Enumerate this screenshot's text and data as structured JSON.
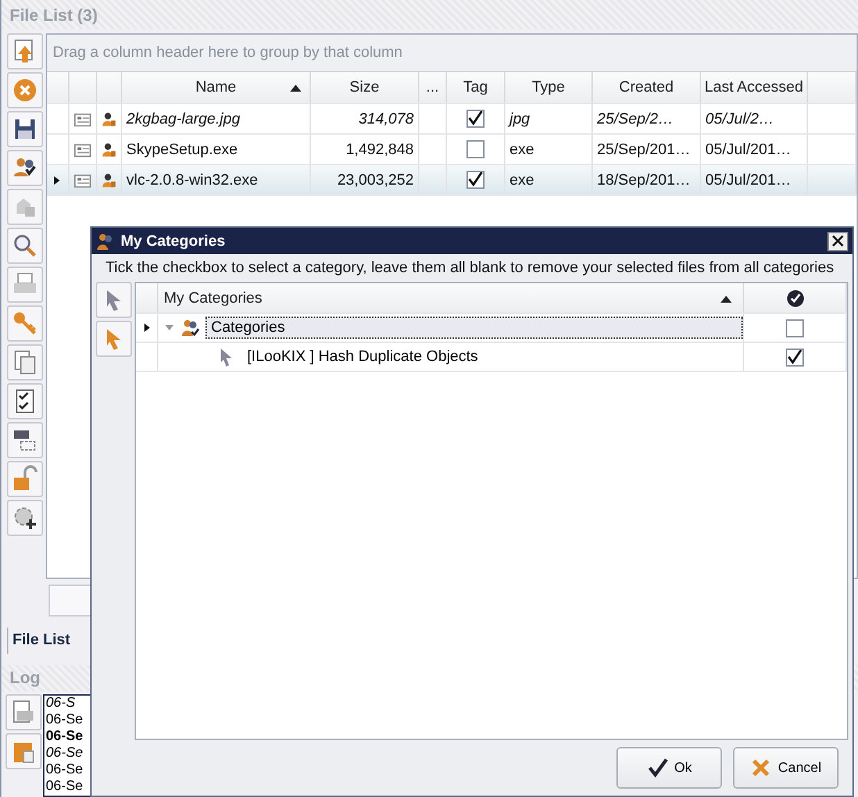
{
  "file_list": {
    "title": "File List (3)",
    "group_hint": "Drag a column header here to group by that column",
    "columns": [
      {
        "label": "Name",
        "sorted": true
      },
      {
        "label": "Size",
        "sorted": false
      },
      {
        "label": "...",
        "sorted": false
      },
      {
        "label": "Tag",
        "sorted": false
      },
      {
        "label": "Type",
        "sorted": false
      },
      {
        "label": "Created",
        "sorted": false
      },
      {
        "label": "Last Accessed",
        "sorted": false
      }
    ],
    "rows": [
      {
        "name": "2kgbag-large.jpg",
        "size": "314,078",
        "tag": true,
        "type": "jpg",
        "created": "25/Sep/2…",
        "accessed": "05/Jul/2…",
        "italic": true,
        "selected": false
      },
      {
        "name": "SkypeSetup.exe",
        "size": "1,492,848",
        "tag": false,
        "type": "exe",
        "created": "25/Sep/201…",
        "accessed": "05/Jul/201…",
        "italic": false,
        "selected": false
      },
      {
        "name": "vlc-2.0.8-win32.exe",
        "size": "23,003,252",
        "tag": true,
        "type": "exe",
        "created": "18/Sep/201…",
        "accessed": "05/Jul/201…",
        "italic": false,
        "selected": true
      }
    ],
    "tab": "File List"
  },
  "log": {
    "title": "Log",
    "lines": [
      {
        "text": "06-S",
        "kind": "italic"
      },
      {
        "text": "06-Se",
        "kind": "normal"
      },
      {
        "text": "06-Se",
        "kind": "bold"
      },
      {
        "text": "06-Se",
        "kind": "italic"
      },
      {
        "text": "06-Se",
        "kind": "normal"
      },
      {
        "text": "06-Se",
        "kind": "normal"
      }
    ]
  },
  "dialog": {
    "title": "My Categories",
    "hint": "Tick the checkbox to select a category, leave them all blank to remove your selected files from all categories",
    "column": "My Categories",
    "tree": [
      {
        "label": "Categories",
        "checked": false,
        "expanded": true,
        "selected": true,
        "children": [
          {
            "label": "[ILooKIX ] Hash Duplicate Objects",
            "checked": true,
            "selected": false
          }
        ]
      }
    ],
    "buttons": [
      "Ok",
      "Cancel"
    ]
  }
}
